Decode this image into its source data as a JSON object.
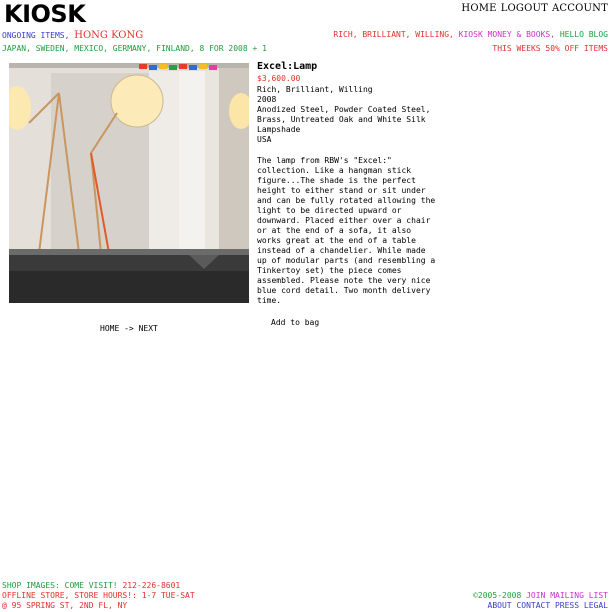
{
  "site": {
    "logo": "KIOSK"
  },
  "topnav": {
    "home": "HOME",
    "logout": "LOGOUT",
    "account": "ACCOUNT"
  },
  "header": {
    "ongoing": "ONGOING ITEMS,",
    "location": "HONG KONG",
    "countries": "JAPAN, SWEDEN, MEXICO, GERMANY, FINLAND, 8 FOR 2008 + 1",
    "right_links": {
      "rbw": "RICH, BRILLIANT, WILLING,",
      "kiosk_books": "KIOSK MONEY & BOOKS,",
      "blog": "HELLO BLOG"
    },
    "sale": "THIS WEEKS 50% OFF ITEMS"
  },
  "product": {
    "title": "Excel:Lamp",
    "price": "$3,600.00",
    "maker": "Rich, Brilliant, Willing",
    "year": "2008",
    "materials": "Anodized Steel, Powder Coated Steel, Brass, Untreated Oak and White Silk Lampshade",
    "country": "USA",
    "description": "The lamp from RBW's \"Excel:\" collection. Like a hangman stick figure...The shade is the perfect height to either stand or sit under and can be fully rotated allowing the light to be directed upward or downward. Placed either over a chair or at the end of a sofa, it also works great at the end of a table instead of a chandelier. While made up of modular parts (and resembling a Tinkertoy set) the piece comes assembled. Please note the very nice blue cord detail. Two month delivery time.",
    "add_to_bag": "Add to bag"
  },
  "pager": {
    "home": "HOME",
    "arrow": "->",
    "next": "NEXT"
  },
  "footer": {
    "shop_images": "SHOP IMAGES:",
    "come_visit": "COME VISIT!",
    "phone": "212-226-8601",
    "offline": "OFFLINE STORE,",
    "hours": "STORE HOURS!: 1-7 TUE-SAT",
    "address": "@ 95 SPRING ST, 2ND FL, NY",
    "copyright": "©2005-2008",
    "join": "JOIN MAILING LIST",
    "about": "ABOUT",
    "contact": "CONTACT",
    "press": "PRESS",
    "legal": "LEGAL"
  }
}
